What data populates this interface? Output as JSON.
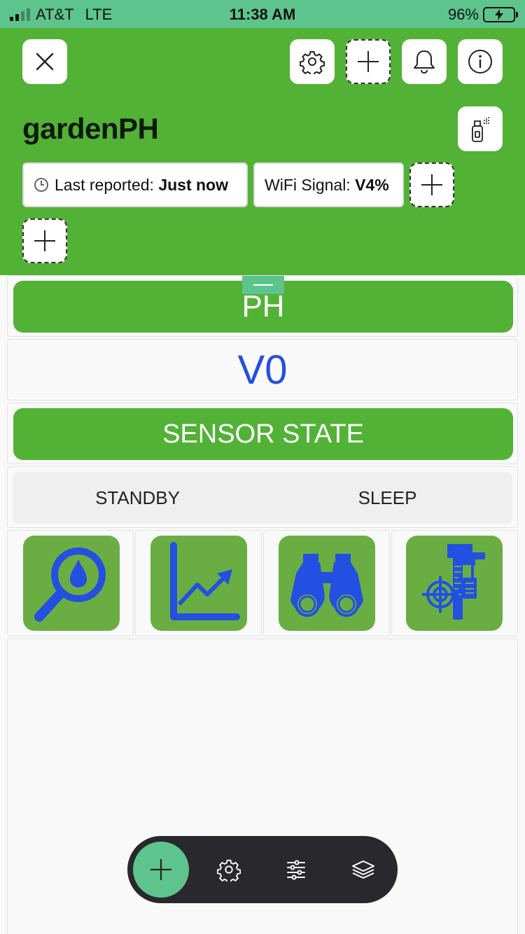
{
  "status_bar": {
    "carrier": "AT&T",
    "network": "LTE",
    "time": "11:38 AM",
    "battery_percent": "96%"
  },
  "header": {
    "title": "gardenPH",
    "last_reported_label": "Last reported:",
    "last_reported_value": "Just now",
    "wifi_label": "WiFi Signal:",
    "wifi_value": "V4%"
  },
  "widgets": {
    "ph_button_label": "PH",
    "value_display": "V0",
    "sensor_state_label": "SENSOR STATE",
    "segments": [
      "STANDBY",
      "SLEEP"
    ]
  },
  "icon_tiles": [
    "magnifier-drop-icon",
    "trend-chart-icon",
    "binoculars-icon",
    "caliper-target-icon"
  ],
  "colors": {
    "status_bar": "#5ec48d",
    "header": "#52b236",
    "icon_tile": "#6aae43",
    "icon_glyph": "#2350e0",
    "value_text": "#2350e0",
    "bottom_bar": "#28282d",
    "fab": "#5ec48d"
  }
}
